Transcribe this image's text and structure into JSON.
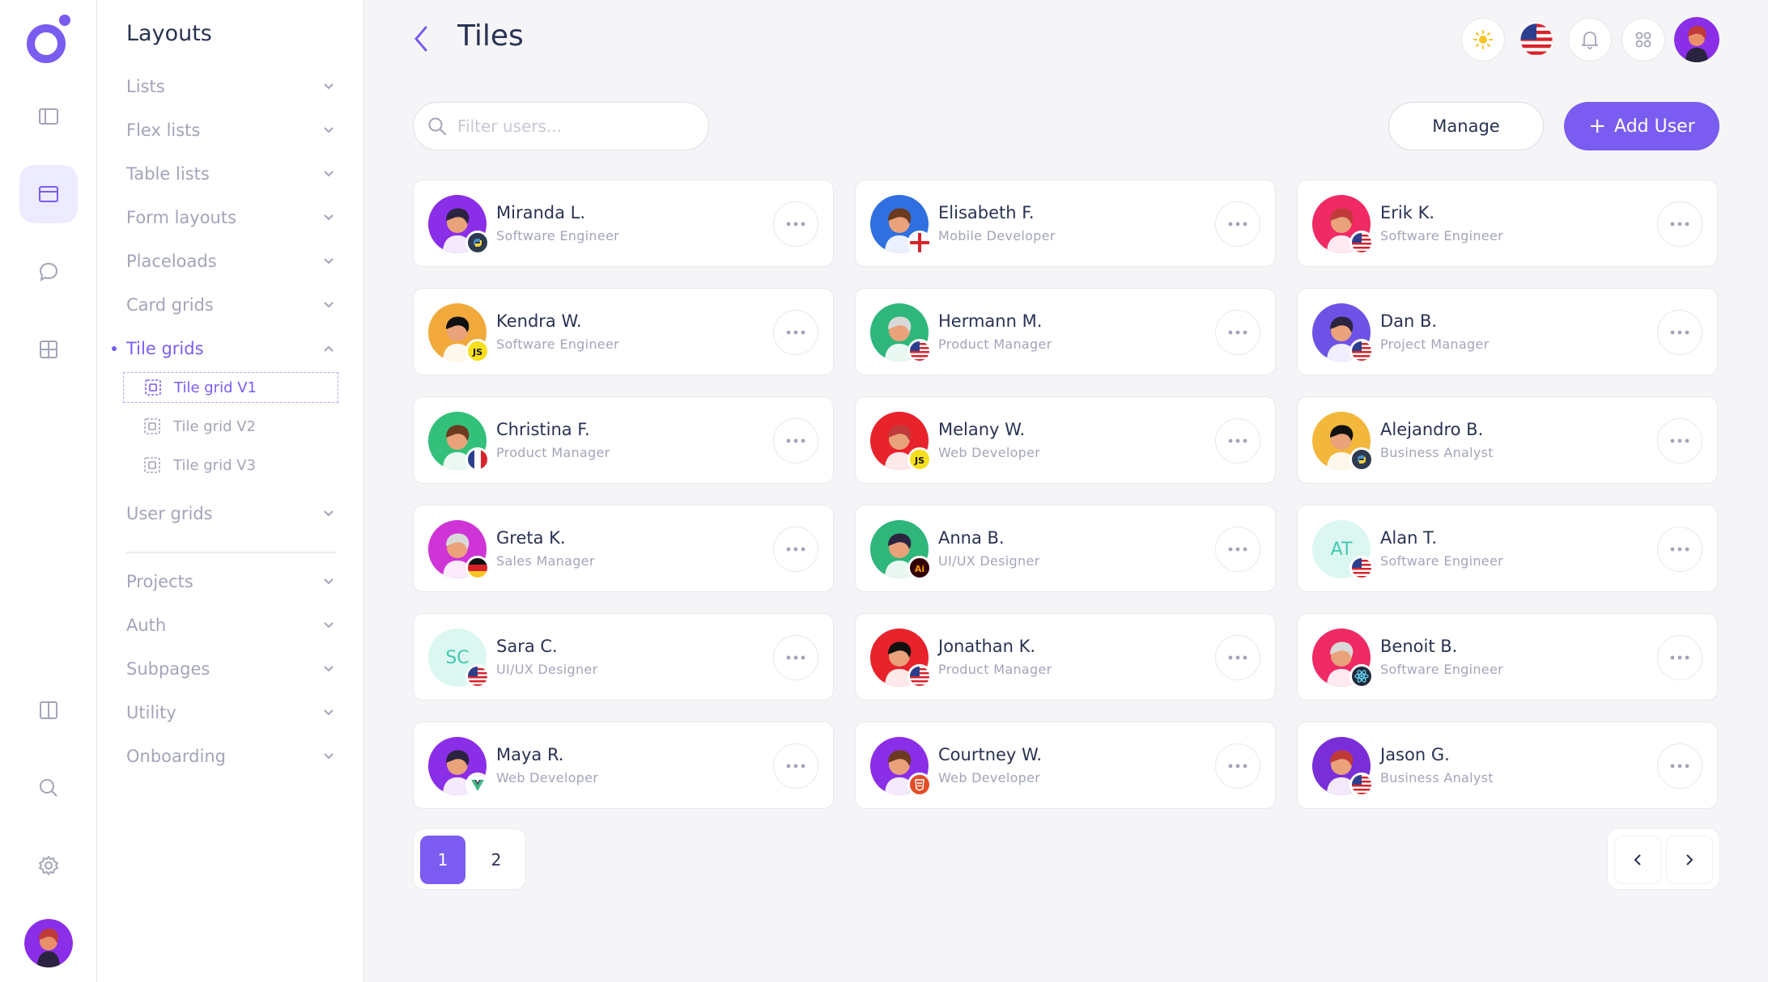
{
  "header": {
    "title": "Tiles"
  },
  "sidebar": {
    "title": "Layouts",
    "items": [
      {
        "label": "Lists"
      },
      {
        "label": "Flex lists"
      },
      {
        "label": "Table lists"
      },
      {
        "label": "Form layouts"
      },
      {
        "label": "Placeloads"
      },
      {
        "label": "Card grids"
      },
      {
        "label": "Tile grids"
      },
      {
        "label": "User grids"
      },
      {
        "label": "Projects"
      },
      {
        "label": "Auth"
      },
      {
        "label": "Subpages"
      },
      {
        "label": "Utility"
      },
      {
        "label": "Onboarding"
      }
    ],
    "subitems": [
      {
        "label": "Tile grid V1"
      },
      {
        "label": "Tile grid V2"
      },
      {
        "label": "Tile grid V3"
      }
    ]
  },
  "toolbar": {
    "search_placeholder": "Filter users...",
    "manage_label": "Manage",
    "add_label": "Add User",
    "add_icon": "+"
  },
  "users": [
    {
      "name": "Miranda L.",
      "role": "Software Engineer",
      "avatar_bg": "#8b2ee8",
      "badge": "python"
    },
    {
      "name": "Elisabeth F.",
      "role": "Mobile Developer",
      "avatar_bg": "#2f6fe0",
      "badge": "england"
    },
    {
      "name": "Erik K.",
      "role": "Software Engineer",
      "avatar_bg": "#ef2a64",
      "badge": "usa"
    },
    {
      "name": "Kendra W.",
      "role": "Software Engineer",
      "avatar_bg": "#f2a93b",
      "badge": "js"
    },
    {
      "name": "Hermann M.",
      "role": "Product Manager",
      "avatar_bg": "#2fb67a",
      "badge": "usa"
    },
    {
      "name": "Dan B.",
      "role": "Project Manager",
      "avatar_bg": "#6e52e6",
      "badge": "usa"
    },
    {
      "name": "Christina F.",
      "role": "Product Manager",
      "avatar_bg": "#32c07a",
      "badge": "france"
    },
    {
      "name": "Melany W.",
      "role": "Web Developer",
      "avatar_bg": "#e8232c",
      "badge": "js"
    },
    {
      "name": "Alejandro B.",
      "role": "Business Analyst",
      "avatar_bg": "#f2b73b",
      "badge": "python"
    },
    {
      "name": "Greta K.",
      "role": "Sales Manager",
      "avatar_bg": "#cf34d6",
      "badge": "germany"
    },
    {
      "name": "Anna B.",
      "role": "UI/UX Designer",
      "avatar_bg": "#2fb67a",
      "badge": "ai"
    },
    {
      "name": "Alan T.",
      "role": "Software Engineer",
      "initials": "AT",
      "badge": "usa"
    },
    {
      "name": "Sara C.",
      "role": "UI/UX Designer",
      "initials": "SC",
      "badge": "usa"
    },
    {
      "name": "Jonathan K.",
      "role": "Product Manager",
      "avatar_bg": "#e8232c",
      "badge": "usa"
    },
    {
      "name": "Benoit B.",
      "role": "Software Engineer",
      "avatar_bg": "#ef2a64",
      "badge": "react"
    },
    {
      "name": "Maya R.",
      "role": "Web Developer",
      "avatar_bg": "#8b2ee8",
      "badge": "vue"
    },
    {
      "name": "Courtney W.",
      "role": "Web Developer",
      "avatar_bg": "#8b2ee8",
      "badge": "html5"
    },
    {
      "name": "Jason G.",
      "role": "Business Analyst",
      "avatar_bg": "#7a2ed8",
      "badge": "usa"
    }
  ],
  "pagination": {
    "pages": [
      "1",
      "2"
    ],
    "current": "1"
  },
  "colors": {
    "accent": "#7b5cf0",
    "text": "#283252",
    "muted": "#a2a5b9"
  }
}
